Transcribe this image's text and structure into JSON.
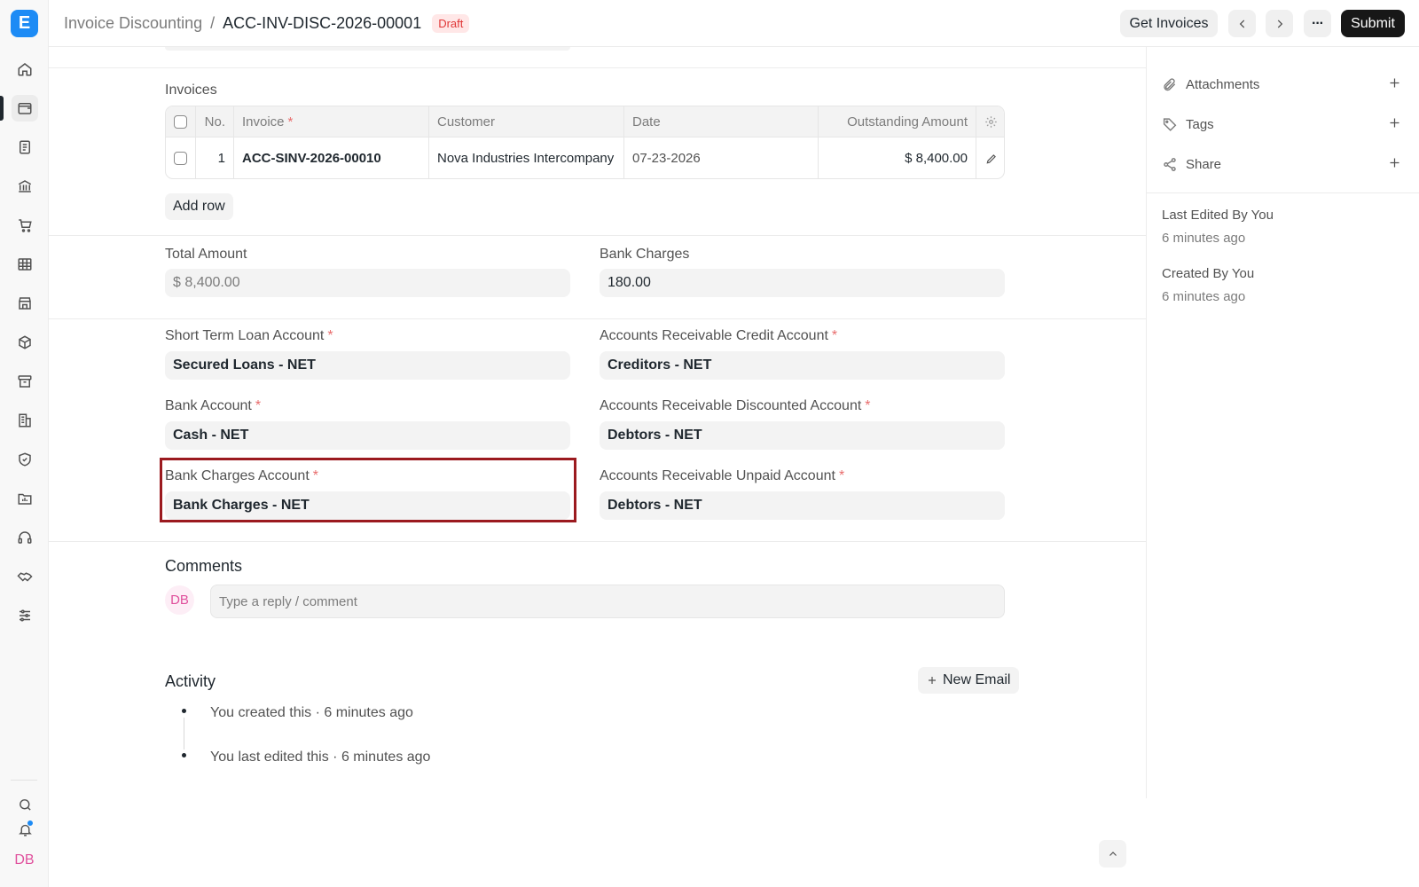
{
  "breadcrumb": {
    "parent": "Invoice Discounting",
    "separator": "/",
    "current": "ACC-INV-DISC-2026-00001",
    "status": "Draft"
  },
  "header": {
    "get_invoices": "Get Invoices",
    "more": "···",
    "submit": "Submit"
  },
  "invoices": {
    "label": "Invoices",
    "columns": {
      "no": "No.",
      "invoice": "Invoice",
      "customer": "Customer",
      "date": "Date",
      "outstanding": "Outstanding Amount"
    },
    "rows": [
      {
        "no": "1",
        "invoice": "ACC-SINV-2026-00010",
        "customer": "Nova Industries Intercompany",
        "date": "07-23-2026",
        "amount": "$ 8,400.00"
      }
    ],
    "add_row": "Add row"
  },
  "totals": {
    "total_amount_label": "Total Amount",
    "total_amount": "$ 8,400.00",
    "bank_charges_label": "Bank Charges",
    "bank_charges": "180.00"
  },
  "accounts": {
    "short_term_loan_label": "Short Term Loan Account",
    "short_term_loan": "Secured Loans - NET",
    "ar_credit_label": "Accounts Receivable Credit Account",
    "ar_credit": "Creditors - NET",
    "bank_account_label": "Bank Account",
    "bank_account": "Cash - NET",
    "ar_discounted_label": "Accounts Receivable Discounted Account",
    "ar_discounted": "Debtors - NET",
    "bank_charges_account_label": "Bank Charges Account",
    "bank_charges_account": "Bank Charges - NET",
    "ar_unpaid_label": "Accounts Receivable Unpaid Account",
    "ar_unpaid": "Debtors - NET"
  },
  "comments": {
    "title": "Comments",
    "avatar": "DB",
    "placeholder": "Type a reply / comment"
  },
  "activity": {
    "title": "Activity",
    "new_email": "New Email",
    "items": [
      "You created this · 6 minutes ago",
      "You last edited this · 6 minutes ago"
    ]
  },
  "right_panel": {
    "attachments": "Attachments",
    "tags": "Tags",
    "share": "Share",
    "last_edited_by": "Last Edited By You",
    "last_edited_time": "6 minutes ago",
    "created_by": "Created By You",
    "created_time": "6 minutes ago"
  },
  "sidebar": {
    "logo": "E",
    "avatar": "DB"
  },
  "colors": {
    "accent": "#1d8bf5",
    "highlight": "#9b1a1f",
    "draft_bg": "#ffe7e7",
    "draft_text": "#e03636"
  }
}
